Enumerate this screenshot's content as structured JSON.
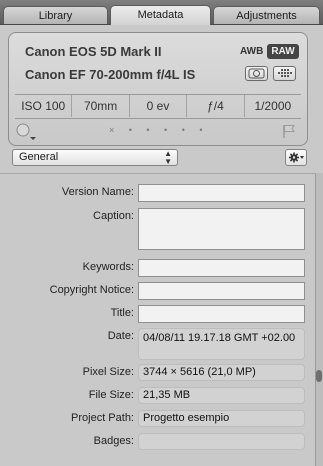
{
  "tabs": [
    {
      "label": "Library",
      "active": false
    },
    {
      "label": "Metadata",
      "active": true
    },
    {
      "label": "Adjustments",
      "active": false
    }
  ],
  "camera_info": {
    "model": "Canon EOS 5D Mark II",
    "lens": "Canon EF 70-200mm f/4L IS",
    "white_balance": "AWB",
    "format_badge": "RAW",
    "exif": [
      "ISO 100",
      "70mm",
      "0 ev",
      "ƒ/4",
      "1/2000"
    ],
    "rating_placeholder": "× • • • • •"
  },
  "toolbar": {
    "preset_value": "General"
  },
  "fields": {
    "version_name": {
      "label": "Version Name:",
      "value": ""
    },
    "caption": {
      "label": "Caption:",
      "value": ""
    },
    "keywords": {
      "label": "Keywords:",
      "value": ""
    },
    "copyright": {
      "label": "Copyright Notice:",
      "value": ""
    },
    "title": {
      "label": "Title:",
      "value": ""
    },
    "date": {
      "label": "Date:",
      "value": "04/08/11 19.17.18 GMT +02.00"
    },
    "pixel_size": {
      "label": "Pixel Size:",
      "value": "3744 × 5616 (21,0 MP)"
    },
    "file_size": {
      "label": "File Size:",
      "value": "21,35 MB"
    },
    "project_path": {
      "label": "Project Path:",
      "value": "Progetto esempio"
    },
    "badges": {
      "label": "Badges:",
      "value": ""
    }
  },
  "colors": {
    "tabbar": "#5c5c5c",
    "panel_bg": "#c9c9c9",
    "raw_badge": "#444444"
  }
}
